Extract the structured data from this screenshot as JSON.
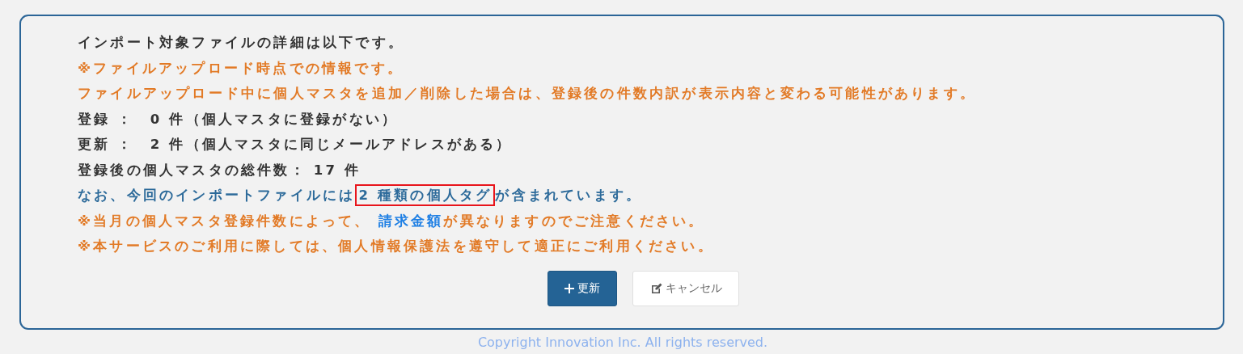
{
  "lines": [
    {
      "kind": "dark",
      "parts": [
        {
          "kind": "plain",
          "text": "インポート対象ファイルの詳細は以下です。"
        }
      ]
    },
    {
      "kind": "warning",
      "parts": [
        {
          "kind": "plain",
          "text": "※ファイルアップロード時点での情報です。"
        }
      ]
    },
    {
      "kind": "warning",
      "parts": [
        {
          "kind": "plain",
          "text": "ファイルアップロード中に個人マスタを追加／削除した場合は、登録後の件数内訳が表示内容と変わる可能性があります。"
        }
      ]
    },
    {
      "kind": "dark",
      "parts": [
        {
          "kind": "plain",
          "text": "登録 ：　0 件（個人マスタに登録がない）"
        }
      ]
    },
    {
      "kind": "dark",
      "parts": [
        {
          "kind": "plain",
          "text": "更新 ：　2 件（個人マスタに同じメールアドレスがある）"
        }
      ]
    },
    {
      "kind": "dark",
      "parts": [
        {
          "kind": "plain",
          "text": "登録後の個人マスタの総件数： 17 件"
        }
      ]
    },
    {
      "kind": "info",
      "parts": [
        {
          "kind": "plain",
          "text": "なお、今回のインポートファイルには"
        },
        {
          "kind": "boxed",
          "text": "2 種類の個人タグ"
        },
        {
          "kind": "plain",
          "text": "が含まれています。"
        }
      ]
    },
    {
      "kind": "warning",
      "parts": [
        {
          "kind": "plain",
          "text": "※当月の個人マスタ登録件数によって、 "
        },
        {
          "kind": "link",
          "text": "請求金額"
        },
        {
          "kind": "plain",
          "text": "が異なりますのでご注意ください。"
        }
      ]
    },
    {
      "kind": "warning",
      "parts": [
        {
          "kind": "plain",
          "text": "※本サービスのご利用に際しては、個人情報保護法を遵守して適正にご利用ください。"
        }
      ]
    }
  ],
  "buttons": [
    {
      "kind": "primary",
      "label": "更新"
    },
    {
      "kind": "secondary",
      "label": "キャンセル"
    }
  ],
  "footer": "Copyright Innovation Inc. All rights reserved."
}
